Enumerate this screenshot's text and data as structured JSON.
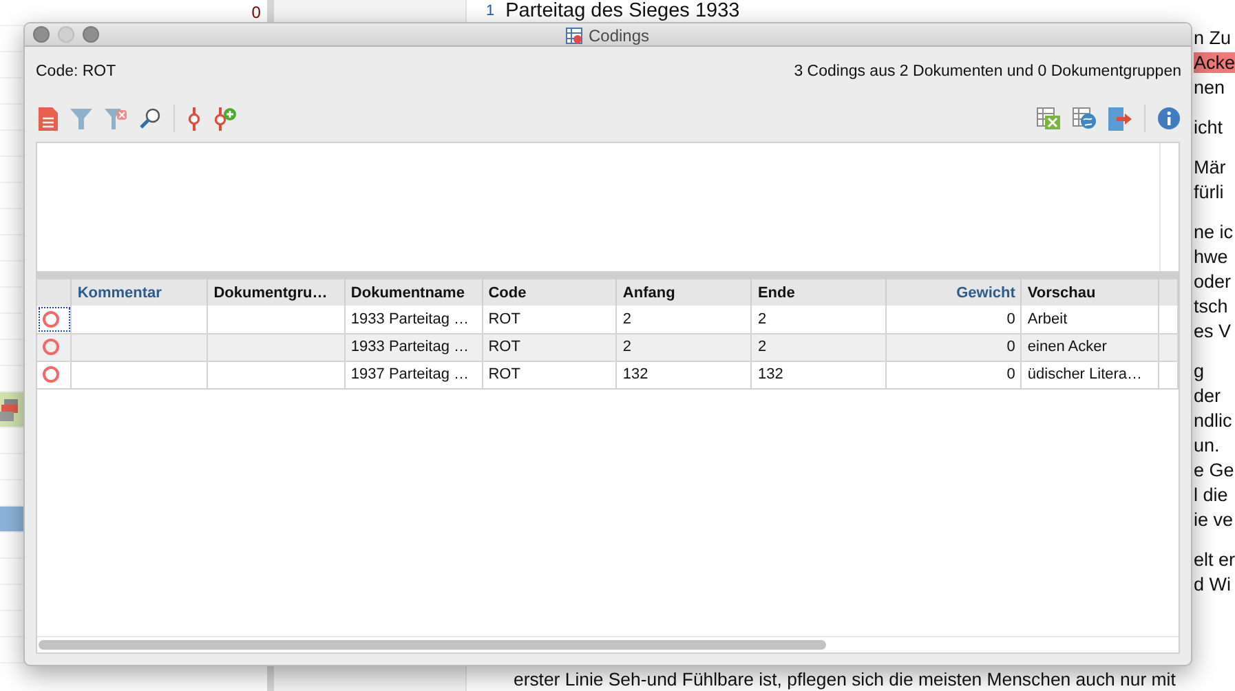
{
  "background": {
    "left_panel": {
      "count": "0",
      "rows": [
        {
          "kind": "plain"
        },
        {
          "kind": "plain"
        },
        {
          "kind": "plain"
        },
        {
          "kind": "plain"
        },
        {
          "kind": "plain"
        },
        {
          "kind": "plain"
        },
        {
          "kind": "plain"
        },
        {
          "kind": "plain"
        },
        {
          "kind": "plain"
        },
        {
          "kind": "plain"
        },
        {
          "kind": "plain"
        },
        {
          "kind": "plain"
        },
        {
          "kind": "plain"
        },
        {
          "kind": "plain"
        },
        {
          "kind": "plain"
        },
        {
          "kind": "tagged"
        },
        {
          "kind": "plain"
        },
        {
          "kind": "plain"
        },
        {
          "kind": "plain"
        },
        {
          "kind": "selected"
        },
        {
          "kind": "plain"
        },
        {
          "kind": "plain"
        },
        {
          "kind": "plain"
        },
        {
          "kind": "plain"
        },
        {
          "kind": "plain"
        }
      ]
    },
    "document": {
      "line_number": "1",
      "title": "Parteitag des Sieges 1933",
      "paragraphs": [
        [
          "n Zu",
          {
            "text": "Acke",
            "highlight": true
          },
          "nen"
        ],
        [
          "icht"
        ],
        [
          "Mär",
          "fürli"
        ],
        [
          "ne ic",
          "hwe",
          "oder",
          "tsch",
          "es V"
        ],
        [
          "g der",
          "ndlic",
          "un.",
          "e Ge",
          "l die",
          "ie ve"
        ],
        [
          "elt er",
          "d Wi"
        ]
      ],
      "last_line": "erster Linie Seh-und Fühlbare ist, pflegen sich die meisten Menschen auch nur mit"
    }
  },
  "window": {
    "title": "Codings",
    "code_label": "Code: ROT",
    "summary": "3 Codings aus 2 Dokumenten und 0 Dokumentgruppen"
  },
  "table": {
    "columns": [
      {
        "label": "Kommentar",
        "emphasized": true,
        "kind": "text"
      },
      {
        "label": "Dokumentgru…",
        "emphasized": false,
        "kind": "text"
      },
      {
        "label": "Dokumentname",
        "emphasized": false,
        "kind": "text"
      },
      {
        "label": "Code",
        "emphasized": false,
        "kind": "text"
      },
      {
        "label": "Anfang",
        "emphasized": false,
        "kind": "text"
      },
      {
        "label": "Ende",
        "emphasized": false,
        "kind": "text"
      },
      {
        "label": "Gewicht",
        "emphasized": true,
        "kind": "number"
      },
      {
        "label": "Vorschau",
        "emphasized": false,
        "kind": "text"
      }
    ],
    "rows": [
      {
        "focused": true,
        "cells": [
          "",
          "",
          "1933 Parteitag …",
          "ROT",
          "2",
          "2",
          "0",
          "Arbeit"
        ]
      },
      {
        "focused": false,
        "cells": [
          "",
          "",
          "1933 Parteitag …",
          "ROT",
          "2",
          "2",
          "0",
          "einen Acker"
        ]
      },
      {
        "focused": false,
        "cells": [
          "",
          "",
          "1937 Parteitag …",
          "ROT",
          "132",
          "132",
          "0",
          "üdischer Litera…"
        ]
      }
    ]
  }
}
